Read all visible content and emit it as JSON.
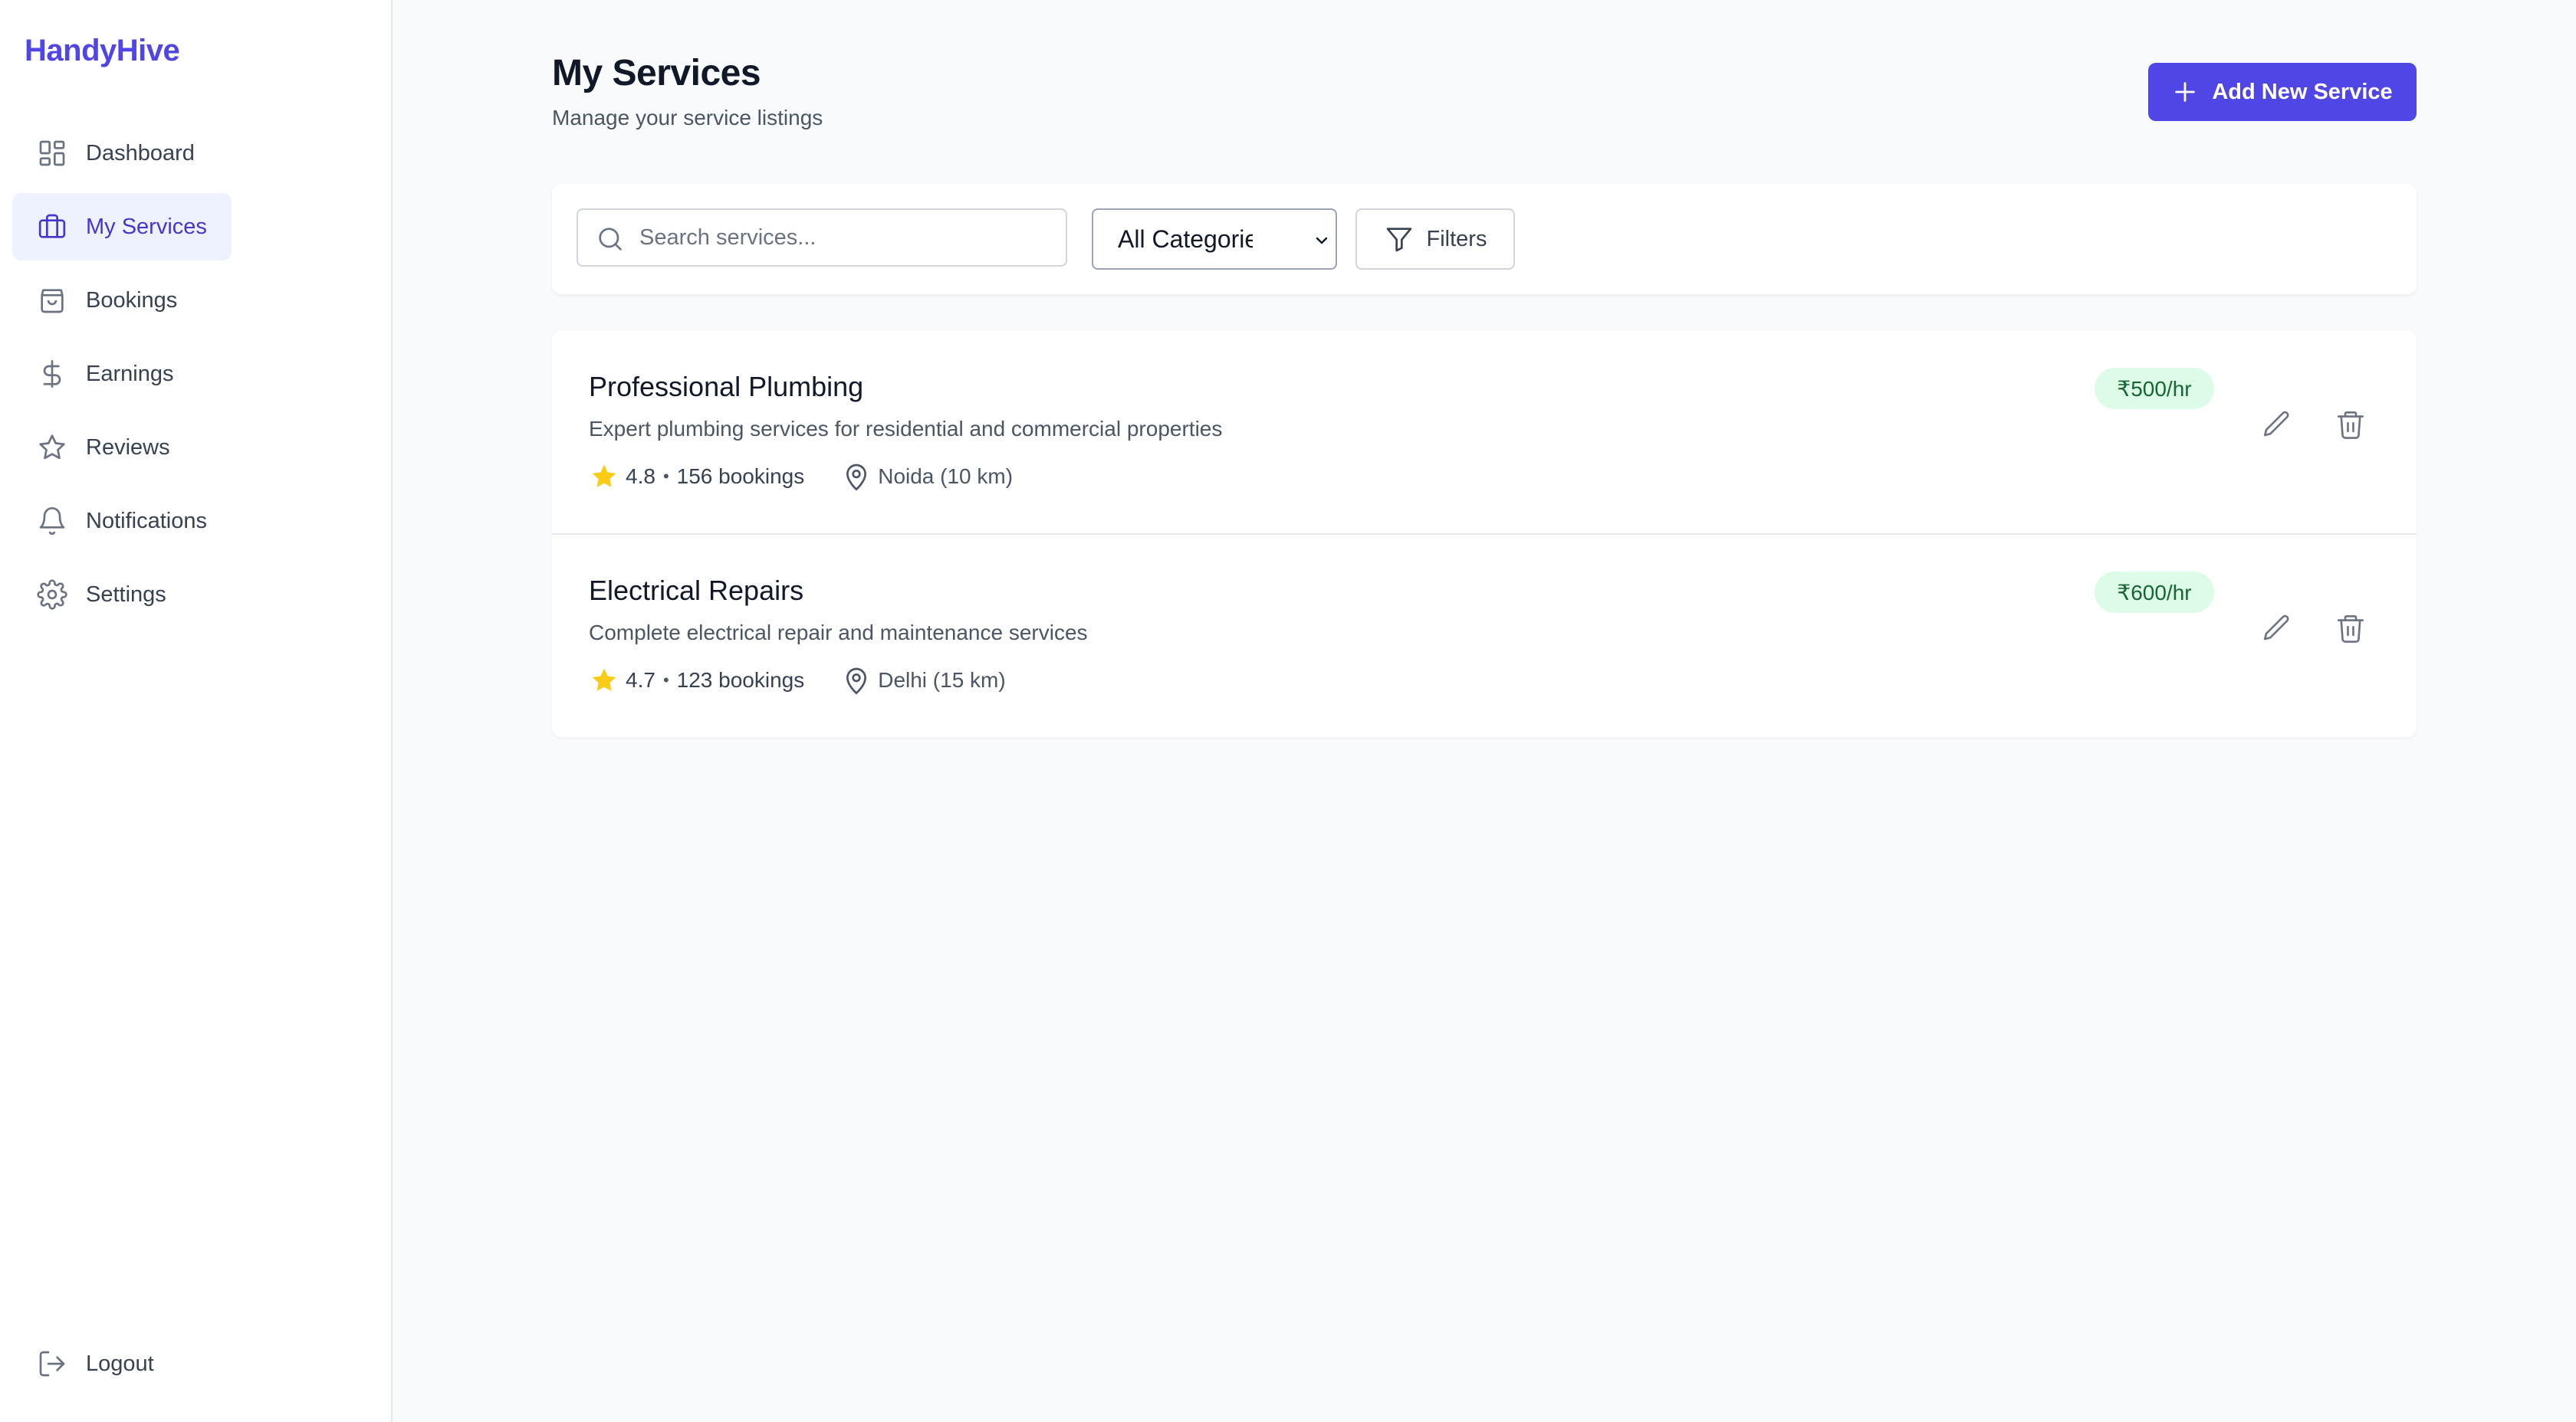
{
  "app": {
    "brand": "HandyHive"
  },
  "sidebar": {
    "items": [
      {
        "label": "Dashboard",
        "icon": "dashboard-icon",
        "active": false
      },
      {
        "label": "My Services",
        "icon": "briefcase-icon",
        "active": true
      },
      {
        "label": "Bookings",
        "icon": "shopping-bag-icon",
        "active": false
      },
      {
        "label": "Earnings",
        "icon": "dollar-icon",
        "active": false
      },
      {
        "label": "Reviews",
        "icon": "star-icon",
        "active": false
      },
      {
        "label": "Notifications",
        "icon": "bell-icon",
        "active": false
      },
      {
        "label": "Settings",
        "icon": "gear-icon",
        "active": false
      }
    ],
    "logout_label": "Logout"
  },
  "header": {
    "title": "My Services",
    "subtitle": "Manage your service listings",
    "add_button_label": "Add New Service"
  },
  "filters": {
    "search_placeholder": "Search services...",
    "search_value": "",
    "category_selected": "All Categories",
    "filters_button_label": "Filters"
  },
  "services": [
    {
      "name": "Professional Plumbing",
      "description": "Expert plumbing services for residential and commercial properties",
      "rating": "4.8",
      "bookings": "156 bookings",
      "location": "Noida (10 km)",
      "price": "₹500/hr"
    },
    {
      "name": "Electrical Repairs",
      "description": "Complete electrical repair and maintenance services",
      "rating": "4.7",
      "bookings": "123 bookings",
      "location": "Delhi (15 km)",
      "price": "₹600/hr"
    }
  ],
  "colors": {
    "accent": "#4f46e5",
    "active_bg": "#eef2ff",
    "price_bg": "#dcfce7",
    "price_text": "#166534",
    "star": "#facc15"
  }
}
